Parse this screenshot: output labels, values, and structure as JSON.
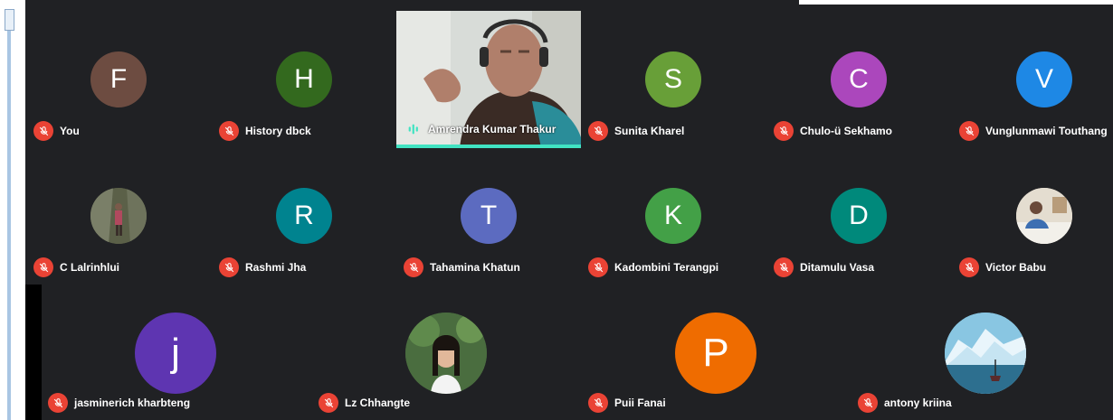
{
  "participants": [
    {
      "name": "You",
      "initial": "F",
      "color": "#6d4c41",
      "type": "letter"
    },
    {
      "name": "History dbck",
      "initial": "H",
      "color": "#33691e",
      "type": "letter"
    },
    {
      "name": "Amrendra Kumar Thakur",
      "type": "video"
    },
    {
      "name": "Sunita Kharel",
      "initial": "S",
      "color": "#689f38",
      "type": "letter"
    },
    {
      "name": "Chulo-ü Sekhamo",
      "initial": "C",
      "color": "#ab47bc",
      "type": "letter"
    },
    {
      "name": "Vunglunmawi Touthang",
      "initial": "V",
      "color": "#1e88e5",
      "type": "letter"
    },
    {
      "name": "C Lalrinhlui",
      "type": "photo",
      "photo": "outdoor"
    },
    {
      "name": "Rashmi Jha",
      "initial": "R",
      "color": "#00838f",
      "type": "letter"
    },
    {
      "name": "Tahamina Khatun",
      "initial": "T",
      "color": "#5c6bc0",
      "type": "letter"
    },
    {
      "name": "Kadombini Terangpi",
      "initial": "K",
      "color": "#43a047",
      "type": "letter"
    },
    {
      "name": "Ditamulu Vasa",
      "initial": "D",
      "color": "#00897b",
      "type": "letter"
    },
    {
      "name": "Victor Babu",
      "type": "photo",
      "photo": "office"
    },
    {
      "name": "jasminerich kharbteng",
      "initial": "j",
      "color": "#5e35b1",
      "type": "letter"
    },
    {
      "name": "Lz Chhangte",
      "type": "photo",
      "photo": "portrait"
    },
    {
      "name": "Puii Fanai",
      "initial": "P",
      "color": "#ef6c00",
      "type": "letter"
    },
    {
      "name": "antony kriina",
      "type": "photo",
      "photo": "iceberg"
    }
  ],
  "icons": {
    "mute": "mic-off-icon",
    "speaking": "audio-wave-icon"
  },
  "colors": {
    "stage": "#202124",
    "mute": "#ea4335",
    "speaking": "#41e3c2"
  }
}
